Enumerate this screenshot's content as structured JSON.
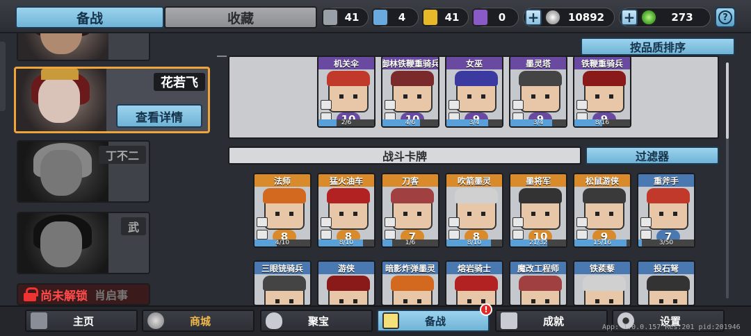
{
  "top_tabs": {
    "active": "备战",
    "inactive": "收藏"
  },
  "resources": [
    {
      "icon": "silver-shard-icon",
      "color": "#9aa0a8",
      "value": "41"
    },
    {
      "icon": "blue-crystal-icon",
      "color": "#6aa8e0",
      "value": "4"
    },
    {
      "icon": "gold-shard-icon",
      "color": "#e6b82a",
      "value": "41"
    },
    {
      "icon": "purple-crystal-icon",
      "color": "#8a5ac8",
      "value": "0"
    }
  ],
  "coins": "10892",
  "gems": "273",
  "help_icon": "?",
  "heroes": {
    "selected": {
      "name": "花若飞",
      "detail_label": "查看详情"
    },
    "others": [
      {
        "name": "丁不二"
      },
      {
        "name": "武"
      }
    ],
    "locked": {
      "status": "尚未解锁",
      "name": "肖启事"
    }
  },
  "sort_label": "按品质排序",
  "deck_cards": [
    {
      "name": "机关伞",
      "level": "10",
      "progress": "2/6",
      "progress_ratio": 0.33,
      "rarity": "purple"
    },
    {
      "name": "御林铁鞭重骑兵",
      "level": "10",
      "progress": "4/6",
      "progress_ratio": 0.67,
      "rarity": "purple"
    },
    {
      "name": "女巫",
      "level": "9",
      "progress": "3/4",
      "progress_ratio": 0.75,
      "rarity": "purple"
    },
    {
      "name": "墨灵塔",
      "level": "9",
      "progress": "3/4",
      "progress_ratio": 0.75,
      "rarity": "purple"
    },
    {
      "name": "铁鞭重骑兵",
      "level": "9",
      "progress": "8/16",
      "progress_ratio": 0.5,
      "rarity": "purple"
    }
  ],
  "section_title": "战斗卡牌",
  "filter_label": "过滤器",
  "battle_cards": [
    {
      "name": "法师",
      "level": "8",
      "progress": "4/10",
      "progress_ratio": 0.4,
      "rarity": "orange"
    },
    {
      "name": "猛火油车",
      "level": "8",
      "progress": "8/10",
      "progress_ratio": 0.8,
      "rarity": "orange"
    },
    {
      "name": "刀客",
      "level": "7",
      "progress": "1/6",
      "progress_ratio": 0.17,
      "rarity": "orange"
    },
    {
      "name": "吹箭墨灵",
      "level": "8",
      "progress": "8/10",
      "progress_ratio": 0.8,
      "rarity": "orange"
    },
    {
      "name": "墨将军",
      "level": "10",
      "progress": "21/32",
      "progress_ratio": 0.66,
      "rarity": "orange"
    },
    {
      "name": "松鼠游侠",
      "level": "9",
      "progress": "15/16",
      "progress_ratio": 0.94,
      "rarity": "orange"
    },
    {
      "name": "重斧手",
      "level": "7",
      "progress": "3/50",
      "progress_ratio": 0.06,
      "rarity": "blue"
    }
  ],
  "partial_cards": [
    {
      "name": "三眼铳骑兵",
      "rarity": "blue"
    },
    {
      "name": "游侠",
      "rarity": "blue"
    },
    {
      "name": "暗影炸弹墨灵",
      "rarity": "blue"
    },
    {
      "name": "熔岩骑士",
      "rarity": "blue"
    },
    {
      "name": "魔改工程师",
      "rarity": "blue"
    },
    {
      "name": "铁蒺藜",
      "rarity": "blue"
    },
    {
      "name": "投石弩",
      "rarity": "blue"
    }
  ],
  "bottom_nav": [
    {
      "label": "主页",
      "icon": "home-icon"
    },
    {
      "label": "商城",
      "icon": "shop-coins-icon"
    },
    {
      "label": "聚宝",
      "icon": "treasure-bowl-icon"
    },
    {
      "label": "备战",
      "icon": "cards-icon"
    },
    {
      "label": "成就",
      "icon": "achievement-icon"
    },
    {
      "label": "设置",
      "icon": "gear-icon"
    }
  ],
  "notification_badge": "!",
  "version_text": "App: 1.0.0.157 Res:201 pid:201946"
}
